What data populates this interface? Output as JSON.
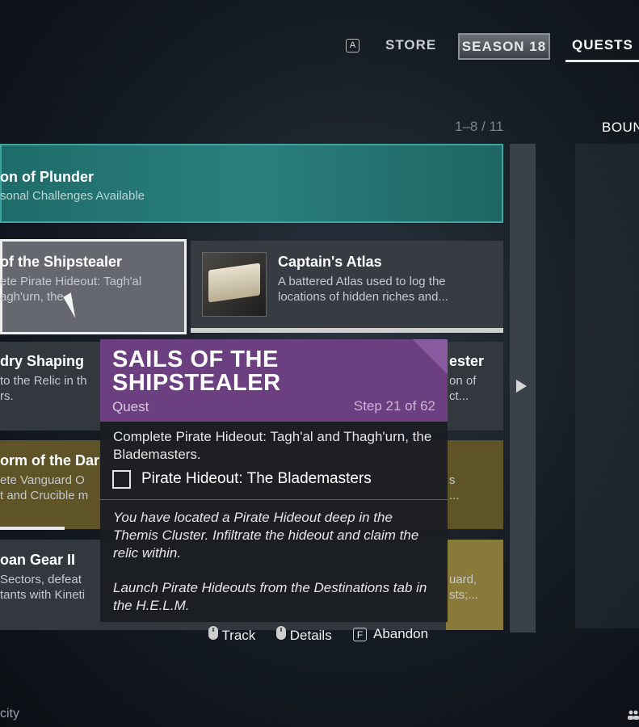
{
  "nav": {
    "key_hint": "A",
    "store": "STORE",
    "season": "SEASON 18",
    "quests": "QUESTS"
  },
  "pager": "1–8 / 11",
  "right_tab": "BOUN",
  "season_card": {
    "title": "on of Plunder",
    "subtitle": "sonal Challenges Available"
  },
  "cards": {
    "selected": {
      "title": "of the Shipstealer",
      "desc": "ete Pirate Hideout: Tagh'al agh'urn, the..."
    },
    "atlas": {
      "title": "Captain's Atlas",
      "desc": "A battered Atlas used to log the locations of hidden riches and..."
    },
    "row3_left": {
      "title": "dry Shaping",
      "desc_line1": "to the Relic in th",
      "desc_line2": "rs."
    },
    "row3_right": {
      "title": "ester",
      "desc_line1": "on of",
      "desc_line2": "ct..."
    },
    "row4_left": {
      "title": "orm of the Dar",
      "desc_line1": "ete Vanguard O",
      "desc_line2": "t and Crucible m"
    },
    "row4_right": {
      "desc_line1": "s",
      "desc_line2": "..."
    },
    "row5_left": {
      "title": "oan Gear II",
      "desc_line1": "Sectors, defeat",
      "desc_line2": "tants with Kineti"
    },
    "row5_right": {
      "desc_line1": "uard,",
      "desc_line2": "sts;..."
    }
  },
  "tooltip": {
    "title": "SAILS OF THE SHIPSTEALER",
    "type": "Quest",
    "step": "Step 21 of 62",
    "objective": "Complete Pirate Hideout: Tagh'al and Thagh'urn, the Blademasters.",
    "checkbox_label": "Pirate Hideout: The Blademasters",
    "lore1": "You have located a Pirate Hideout deep in the Themis Cluster. Infiltrate the hideout and claim the relic within.",
    "lore2": "Launch Pirate Hideouts from the Destinations tab in the H.E.L.M.",
    "actions": {
      "track": "Track",
      "details": "Details",
      "abandon_key": "F",
      "abandon": "Abandon"
    }
  },
  "bottom_left": "city",
  "colors": {
    "season_teal": "#2a7f7d",
    "tooltip_purple": "#6c3f80",
    "gold_card": "#5e5428"
  }
}
